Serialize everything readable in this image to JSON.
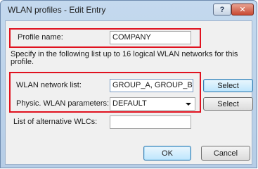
{
  "window": {
    "title": "WLAN profiles - Edit Entry",
    "help_label": "?",
    "close_label": "✕"
  },
  "form": {
    "profile_name_label": "Profile name:",
    "profile_name_value": "COMPANY",
    "description": "Specify in the following list up to 16 logical WLAN networks for this profile.",
    "network_list_label": "WLAN network list:",
    "network_list_value": "GROUP_A, GROUP_B",
    "network_list_button": "Select",
    "physic_label": "Physic. WLAN parameters:",
    "physic_value": "DEFAULT",
    "physic_button": "Select",
    "alt_wlcs_label": "List of alternative WLCs:",
    "alt_wlcs_value": ""
  },
  "footer": {
    "ok_label": "OK",
    "cancel_label": "Cancel"
  },
  "colors": {
    "highlight": "#e0121f",
    "titlebar": "#c4d9ee"
  }
}
